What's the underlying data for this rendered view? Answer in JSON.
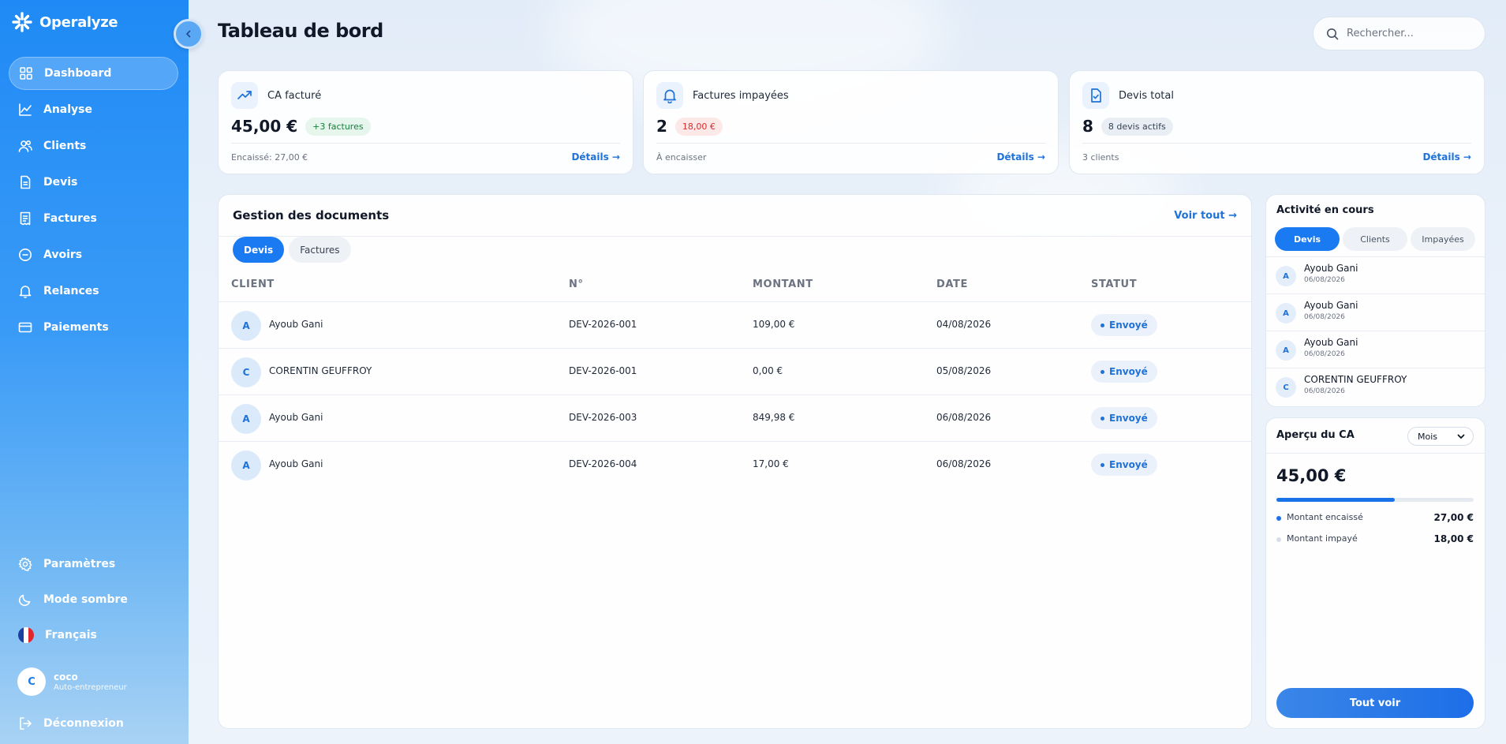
{
  "app": {
    "name": "Operalyze"
  },
  "sidebar": {
    "items": [
      {
        "label": "Dashboard",
        "icon": "grid-icon"
      },
      {
        "label": "Analyse",
        "icon": "chart-line-icon"
      },
      {
        "label": "Clients",
        "icon": "users-icon"
      },
      {
        "label": "Devis",
        "icon": "file-icon"
      },
      {
        "label": "Factures",
        "icon": "receipt-icon"
      },
      {
        "label": "Avoirs",
        "icon": "minus-circle-icon"
      },
      {
        "label": "Relances",
        "icon": "bell-icon"
      },
      {
        "label": "Paiements",
        "icon": "credit-card-icon"
      }
    ],
    "bottom": {
      "settings": "Paramètres",
      "dark_mode": "Mode sombre",
      "language": "Français"
    },
    "user": {
      "initial": "C",
      "name": "coco",
      "role": "Auto-entrepreneur"
    },
    "logout": "Déconnexion"
  },
  "header": {
    "title": "Tableau de bord",
    "search_placeholder": "Rechercher..."
  },
  "stats": [
    {
      "label": "CA facturé",
      "value": "45,00 €",
      "badge": "+3 factures",
      "footer": "Encaissé: 27,00 €",
      "link": "Détails →"
    },
    {
      "label": "Factures impayées",
      "value": "2",
      "badge": "18,00 €",
      "footer": "À encaisser",
      "link": "Détails →"
    },
    {
      "label": "Devis total",
      "value": "8",
      "badge": "8 devis actifs",
      "footer": "3 clients",
      "link": "Détails →"
    }
  ],
  "documents": {
    "title": "Gestion des documents",
    "view_all": "Voir tout →",
    "tabs": [
      "Devis",
      "Factures"
    ],
    "columns": [
      "CLIENT",
      "N°",
      "MONTANT",
      "DATE",
      "STATUT"
    ],
    "rows": [
      {
        "initial": "A",
        "client": "Ayoub Gani",
        "number": "DEV-2026-001",
        "amount": "109,00 €",
        "date": "04/08/2026",
        "status": "Envoyé"
      },
      {
        "initial": "C",
        "client": "CORENTIN GEUFFROY",
        "number": "DEV-2026-001",
        "amount": "0,00 €",
        "date": "05/08/2026",
        "status": "Envoyé"
      },
      {
        "initial": "A",
        "client": "Ayoub Gani",
        "number": "DEV-2026-003",
        "amount": "849,98 €",
        "date": "06/08/2026",
        "status": "Envoyé"
      },
      {
        "initial": "A",
        "client": "Ayoub Gani",
        "number": "DEV-2026-004",
        "amount": "17,00 €",
        "date": "06/08/2026",
        "status": "Envoyé"
      }
    ]
  },
  "activity": {
    "title": "Activité en cours",
    "tabs": [
      "Devis",
      "Clients",
      "Impayées"
    ],
    "items": [
      {
        "initial": "A",
        "name": "Ayoub Gani",
        "date": "06/08/2026"
      },
      {
        "initial": "A",
        "name": "Ayoub Gani",
        "date": "06/08/2026"
      },
      {
        "initial": "A",
        "name": "Ayoub Gani",
        "date": "06/08/2026"
      },
      {
        "initial": "C",
        "name": "CORENTIN GEUFFROY",
        "date": "06/08/2026"
      }
    ]
  },
  "ca_overview": {
    "title": "Aperçu du CA",
    "period": "Mois",
    "value": "45,00 €",
    "progress_fraction": 0.6,
    "legend": [
      {
        "label": "Montant encaissé",
        "value": "27,00 €",
        "color": "#1a72e8"
      },
      {
        "label": "Montant impayé",
        "value": "18,00 €",
        "color": "#d8dee8"
      }
    ],
    "button": "Tout voir"
  },
  "colors": {
    "accent": "#1a7af2",
    "sidebar": "#1f8af5"
  }
}
